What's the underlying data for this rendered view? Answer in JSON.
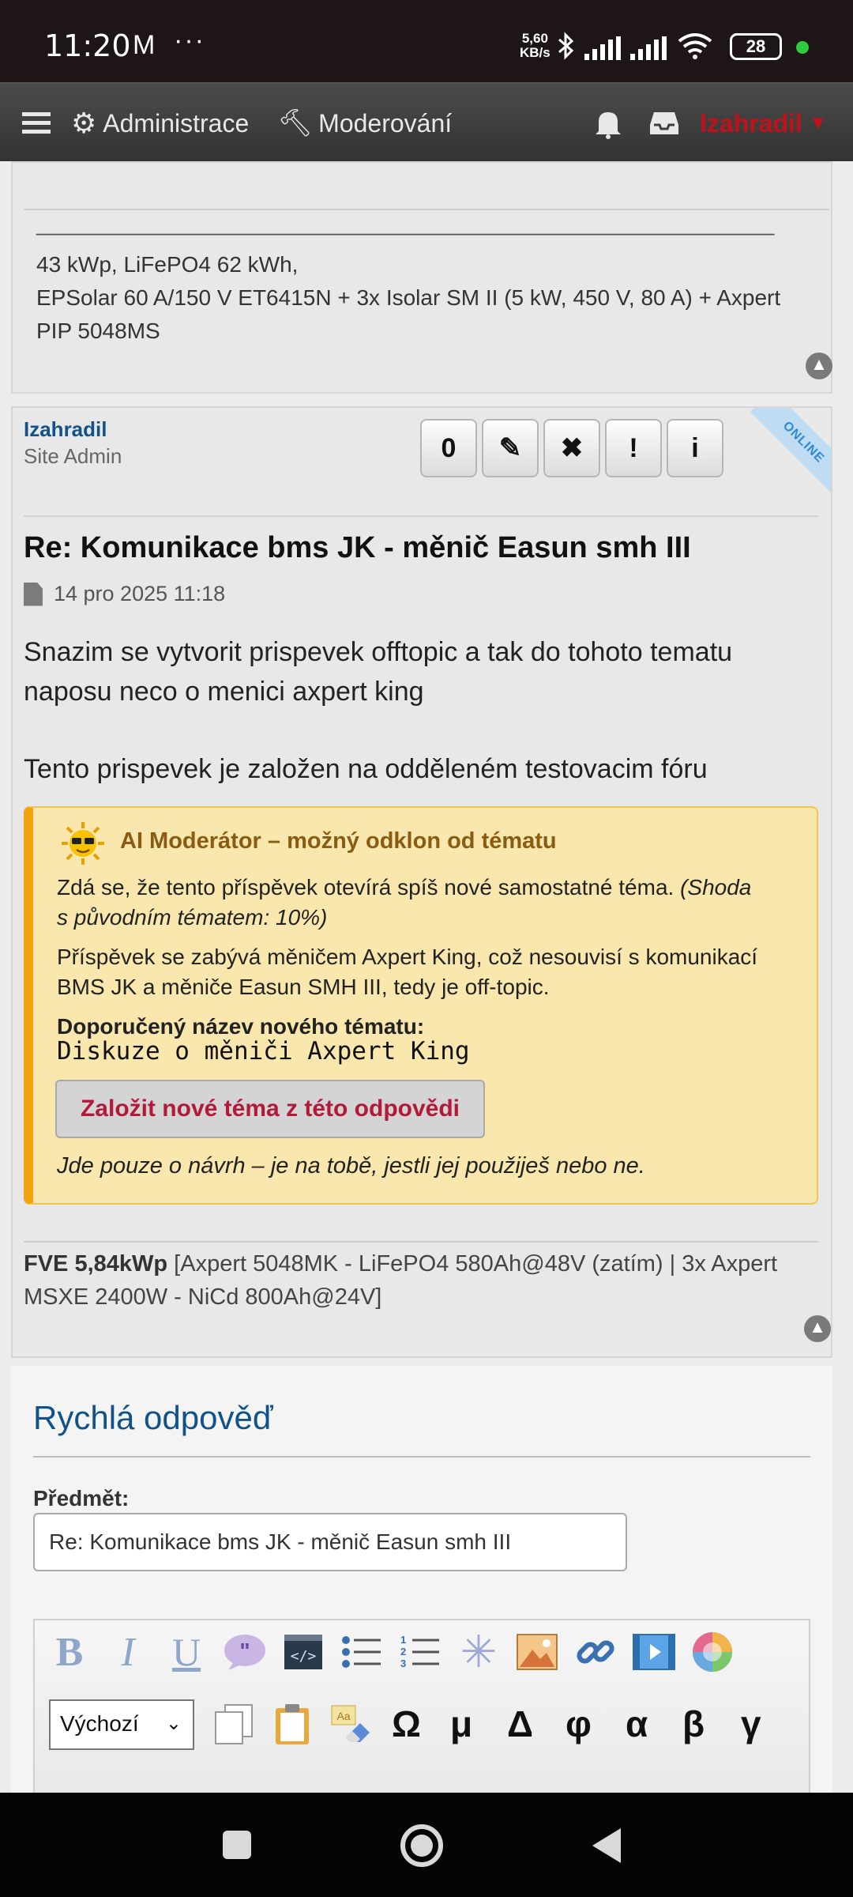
{
  "status": {
    "time": "11:20",
    "speed": "5,60\nKB/s",
    "battery": "28"
  },
  "nav": {
    "admin": "Administrace",
    "moderate": "Moderování",
    "user": "Izahradil"
  },
  "prev_post": {
    "sig_rule": "____________________________________________________________",
    "sig_line1": "43 kWp, LiFePO4 62 kWh,",
    "sig_line2": "EPSolar 60 A/150 V ET6415N + 3x Isolar SM II (5 kW, 450 V, 80 A) + Axpert",
    "sig_line3": "PIP 5048MS"
  },
  "post": {
    "author": "Izahradil",
    "rank": "Site Admin",
    "online": "ONLINE",
    "buttons": [
      "0",
      "✎",
      "✖",
      "!",
      "i"
    ],
    "title": "Re: Komunikace bms JK - měnič Easun smh III",
    "date": "14 pro 2025 11:18",
    "body1": "Snazim se vytvorit prispevek offtopic a tak do tohoto tematu",
    "body2": "naposu neco o menici axpert king",
    "body3": "Tento prispevek je založen na odděleném testovacim fóru",
    "sig_bold": "FVE 5,84kWp",
    "sig_rest": " [Axpert 5048MK - LiFePO4 580Ah@48V (zatím) | 3x Axpert",
    "sig_line2": "MSXE 2400W - NiCd 800Ah@24V]"
  },
  "ai": {
    "heading": "AI Moderátor – možný odklon od tématu",
    "line1a": "Zdá se, že tento příspěvek otevírá spíš nové samostatné téma. ",
    "line1b": "(Shoda",
    "line2": "s původním tématem: 10%)",
    "line3": "Příspěvek se zabývá měničem Axpert King, což nesouvisí s komunikací",
    "line4": "BMS JK a měniče Easun SMH III, tedy je off-topic.",
    "suggest_label": "Doporučený název nového tématu:",
    "suggest_value": "Diskuze o měniči Axpert King",
    "button": "Založit nové téma z této odpovědi",
    "note": "Jde pouze o návrh – je na tobě, jestli jej použiješ nebo ne."
  },
  "quick_reply": {
    "title": "Rychlá odpověď",
    "subject_label": "Předmět:",
    "subject_value": "Re: Komunikace bms JK - měnič Easun smh III",
    "font_select": "Výchozí",
    "symbols": [
      "Ω",
      "μ",
      "Δ",
      "φ",
      "α",
      "β",
      "γ"
    ]
  }
}
